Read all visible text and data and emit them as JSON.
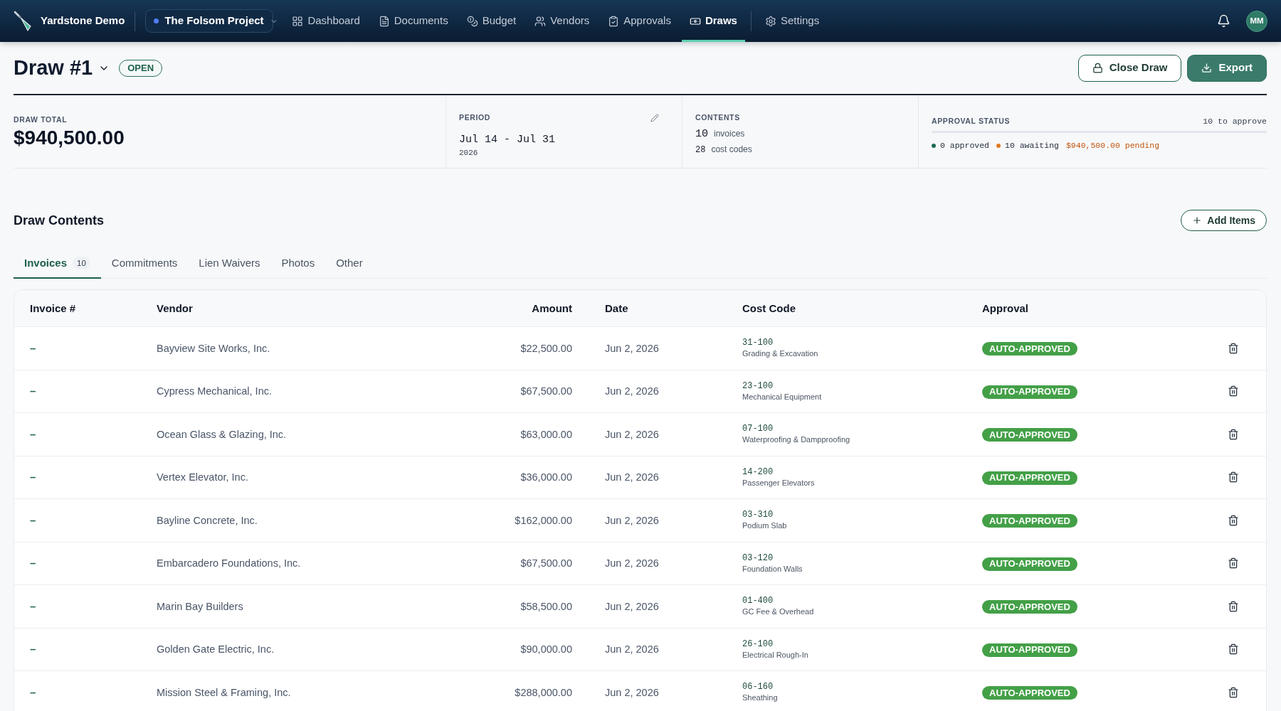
{
  "app": {
    "name": "Yardstone Demo"
  },
  "project_selector": {
    "label": "The Folsom Project"
  },
  "nav": [
    {
      "label": "Dashboard",
      "selected": false
    },
    {
      "label": "Documents",
      "selected": false
    },
    {
      "label": "Budget",
      "selected": false
    },
    {
      "label": "Vendors",
      "selected": false
    },
    {
      "label": "Approvals",
      "selected": false
    },
    {
      "label": "Draws",
      "selected": true
    }
  ],
  "settings_link": {
    "label": "Settings"
  },
  "user": {
    "initials": "MM"
  },
  "draw": {
    "title": "Draw #1",
    "status": "OPEN"
  },
  "actions": [
    {
      "label": "Close Draw",
      "kind": "outline"
    },
    {
      "label": "Export",
      "kind": "primary"
    }
  ],
  "summary": {
    "draw_total": {
      "label": "DRAW TOTAL",
      "value": "$940,500.00"
    },
    "period": {
      "label": "PERIOD",
      "range": "Jul 14 - Jul 31",
      "year": "2026"
    },
    "contents": {
      "label": "CONTENTS",
      "items": [
        {
          "count": "10",
          "unit": "invoices"
        },
        {
          "count": "28",
          "unit": "cost codes"
        }
      ]
    },
    "approval_status": {
      "label": "APPROVAL STATUS",
      "remaining": "10 to approve",
      "level": 0,
      "legend": [
        {
          "text": "0 approved",
          "color": "#1f6b57"
        },
        {
          "text": "10 awaiting",
          "color": "#e07a22"
        }
      ],
      "pending": "$940,500.00 pending"
    }
  },
  "section": {
    "title": "Draw Contents",
    "add_button": "Add Items"
  },
  "tabs": [
    {
      "label": "Invoices",
      "count": "10",
      "selected": true
    },
    {
      "label": "Commitments",
      "selected": false
    },
    {
      "label": "Lien Waivers",
      "selected": false
    },
    {
      "label": "Photos",
      "selected": false
    },
    {
      "label": "Other",
      "selected": false
    }
  ],
  "table": {
    "columns": [
      "Invoice #",
      "Vendor",
      "Amount",
      "Date",
      "Cost Code",
      "Approval"
    ],
    "rows": [
      {
        "invoice": "–",
        "vendor": "Bayview Site Works, Inc.",
        "amount": "$22,500.00",
        "date": "Jun 2, 2026",
        "cost_code": "31-100",
        "cost_description": "Grading & Excavation",
        "approval": "AUTO-APPROVED"
      },
      {
        "invoice": "–",
        "vendor": "Cypress Mechanical, Inc.",
        "amount": "$67,500.00",
        "date": "Jun 2, 2026",
        "cost_code": "23-100",
        "cost_description": "Mechanical Equipment",
        "approval": "AUTO-APPROVED"
      },
      {
        "invoice": "–",
        "vendor": "Ocean Glass & Glazing, Inc.",
        "amount": "$63,000.00",
        "date": "Jun 2, 2026",
        "cost_code": "07-100",
        "cost_description": "Waterproofing & Dampproofing",
        "approval": "AUTO-APPROVED"
      },
      {
        "invoice": "–",
        "vendor": "Vertex Elevator, Inc.",
        "amount": "$36,000.00",
        "date": "Jun 2, 2026",
        "cost_code": "14-200",
        "cost_description": "Passenger Elevators",
        "approval": "AUTO-APPROVED"
      },
      {
        "invoice": "–",
        "vendor": "Bayline Concrete, Inc.",
        "amount": "$162,000.00",
        "date": "Jun 2, 2026",
        "cost_code": "03-310",
        "cost_description": "Podium Slab",
        "approval": "AUTO-APPROVED"
      },
      {
        "invoice": "–",
        "vendor": "Embarcadero Foundations, Inc.",
        "amount": "$67,500.00",
        "date": "Jun 2, 2026",
        "cost_code": "03-120",
        "cost_description": "Foundation Walls",
        "approval": "AUTO-APPROVED"
      },
      {
        "invoice": "–",
        "vendor": "Marin Bay Builders",
        "amount": "$58,500.00",
        "date": "Jun 2, 2026",
        "cost_code": "01-400",
        "cost_description": "GC Fee & Overhead",
        "approval": "AUTO-APPROVED"
      },
      {
        "invoice": "–",
        "vendor": "Golden Gate Electric, Inc.",
        "amount": "$90,000.00",
        "date": "Jun 2, 2026",
        "cost_code": "26-100",
        "cost_description": "Electrical Rough-In",
        "approval": "AUTO-APPROVED"
      },
      {
        "invoice": "–",
        "vendor": "Mission Steel & Framing, Inc.",
        "amount": "$288,000.00",
        "date": "Jun 2, 2026",
        "cost_code": "06-160",
        "cost_description": "Sheathing",
        "approval": "AUTO-APPROVED"
      }
    ]
  }
}
